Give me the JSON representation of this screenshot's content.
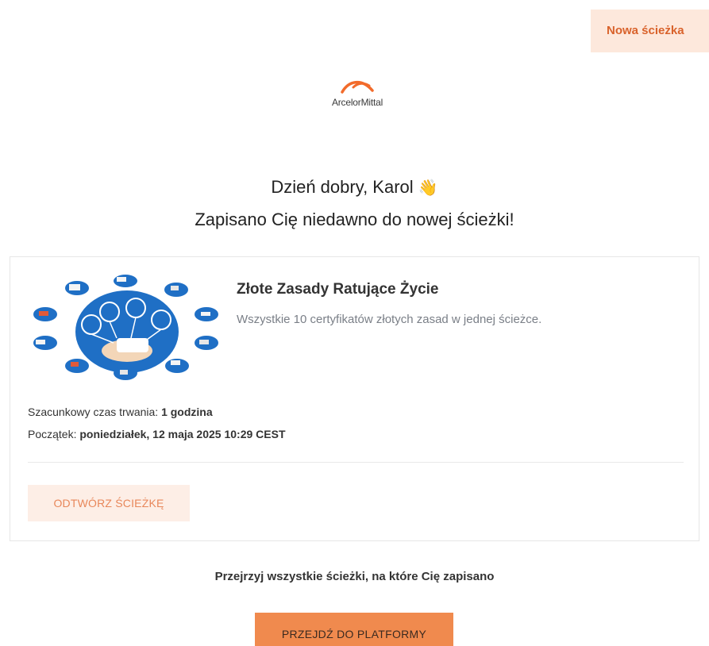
{
  "header": {
    "badge_label": "Nowa ścieżka"
  },
  "brand": {
    "logo_text": "ArcelorMittal",
    "logo_color": "#f26b2b"
  },
  "greeting": {
    "line1": "Dzień dobry, Karol",
    "wave": "👋",
    "line2": "Zapisano Cię niedawno do nowej ścieżki!"
  },
  "course": {
    "title": "Złote Zasady Ratujące Życie",
    "description": "Wszystkie 10 certyfikatów złotych zasad w jednej ścieżce.",
    "duration_label": "Szacunkowy czas trwania:",
    "duration_value": "1 godzina",
    "start_label": "Początek:",
    "start_value": "poniedziałek, 12 maja 2025 10:29 CEST",
    "open_button": "ODTWÓRZ ŚCIEŻKĘ"
  },
  "footer": {
    "browse_text": "Przejrzyj wszystkie ścieżki, na które Cię zapisano",
    "platform_button": "PRZEJDŹ DO PLATFORMY"
  },
  "colors": {
    "accent": "#f08a4e",
    "badge_bg": "#fde8dc",
    "badge_text": "#d9622b",
    "circle_blue": "#1f6fc5"
  }
}
